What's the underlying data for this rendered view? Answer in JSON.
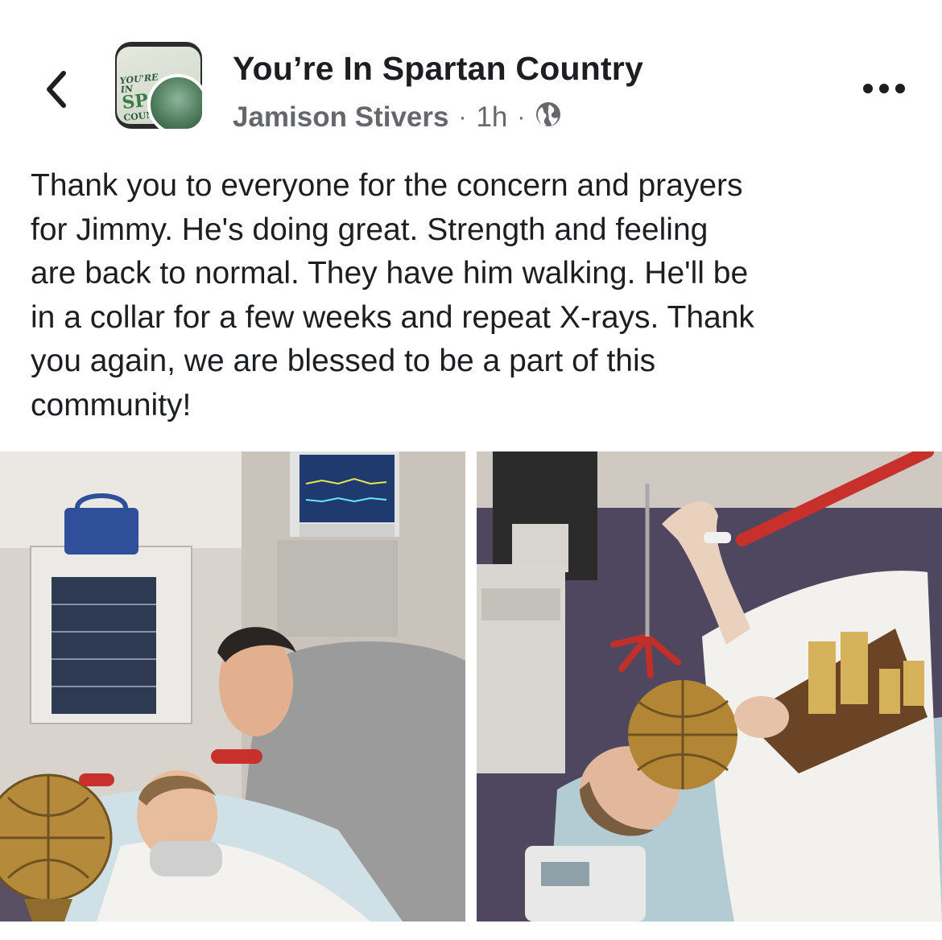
{
  "header": {
    "back_icon": "chevron-left-icon",
    "avatar": {
      "logo_lines": [
        "YOU'RE IN",
        "SPA",
        "COUNT"
      ]
    },
    "page_name": "You’re In Spartan Country",
    "author": "Jamison Stivers",
    "separator": "·",
    "time": "1h",
    "audience_icon": "globe-icon",
    "more_icon": "more-horizontal-icon"
  },
  "post": {
    "text": "Thank you to everyone for the concern and prayers\nfor Jimmy.   He's doing great.  Strength and feeling\nare back to normal.  They have him walking.  He'll be\nin a collar for a few weeks and repeat X-rays.  Thank\nyou again, we are blessed to be a part of this\ncommunity!"
  },
  "photos": [
    {
      "name": "hospital-photo-left"
    },
    {
      "name": "hospital-photo-right"
    }
  ],
  "colors": {
    "text": "#1c1e21",
    "secondary_text": "#65676b",
    "background": "#ffffff"
  }
}
